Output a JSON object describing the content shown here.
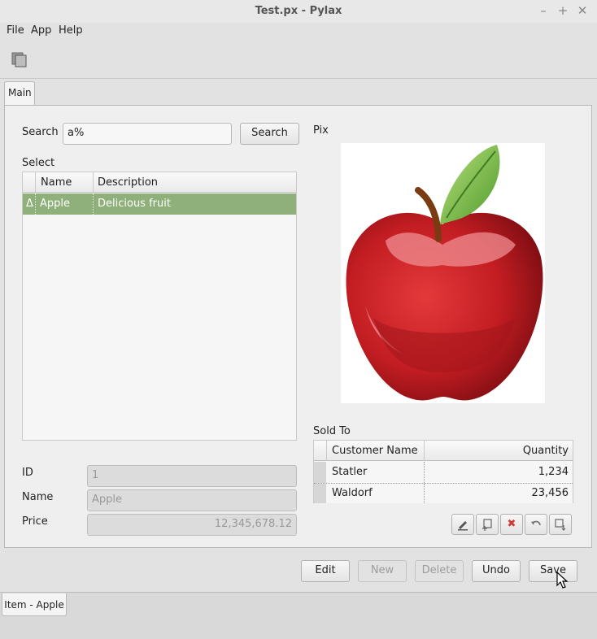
{
  "window": {
    "title": "Test.px - Pylax",
    "min": "–",
    "max": "+",
    "close": "✕"
  },
  "menu": {
    "file": "File",
    "app": "App",
    "help": "Help"
  },
  "tabs": {
    "main": "Main"
  },
  "search": {
    "label": "Search",
    "value": "a%",
    "button": "Search"
  },
  "select": {
    "label": "Select",
    "columns": [
      "Name",
      "Description"
    ],
    "rows": [
      {
        "marker": "Δ",
        "name": "Apple",
        "description": "Delicious fruit"
      }
    ]
  },
  "fields": {
    "id_label": "ID",
    "id_value": "1",
    "name_label": "Name",
    "name_value": "Apple",
    "price_label": "Price",
    "price_value": "12,345,678.12"
  },
  "pix": {
    "label": "Pix"
  },
  "sold_to": {
    "label": "Sold To",
    "columns": [
      "Customer Name",
      "Quantity"
    ],
    "rows": [
      {
        "customer": "Statler",
        "quantity": "1,234"
      },
      {
        "customer": "Waldorf",
        "quantity": "23,456"
      }
    ]
  },
  "actions": {
    "edit": "Edit",
    "new": "New",
    "delete": "Delete",
    "undo": "Undo",
    "save": "Save"
  },
  "status": {
    "item": "Item  -  Apple"
  },
  "icons": {
    "toolbar": "copy-icon",
    "sold_to_buttons": [
      "edit-icon",
      "insert-row-icon",
      "delete-icon",
      "undo-icon",
      "export-icon"
    ]
  },
  "colors": {
    "selection": "#8fb07a",
    "delete_icon": "#d23a3a"
  }
}
